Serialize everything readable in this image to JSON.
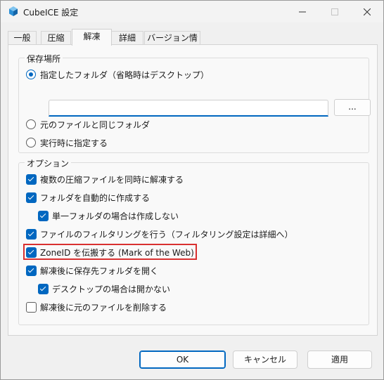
{
  "window": {
    "title": "CubeICE 設定"
  },
  "tabs": [
    "一般",
    "圧縮",
    "解凍",
    "詳細",
    "バージョン情報"
  ],
  "active_tab": "解凍",
  "save_location": {
    "label": "保存場所",
    "options": [
      {
        "label": "指定したフォルダ（省略時はデスクトップ）",
        "selected": true
      },
      {
        "label": "元のファイルと同じフォルダ",
        "selected": false
      },
      {
        "label": "実行時に指定する",
        "selected": false
      }
    ],
    "path_value": "",
    "browse_label": "..."
  },
  "options": {
    "label": "オプション",
    "items": [
      {
        "label": "複数の圧縮ファイルを同時に解凍する",
        "checked": true
      },
      {
        "label": "フォルダを自動的に作成する",
        "checked": true
      },
      {
        "label": "単一フォルダの場合は作成しない",
        "checked": true
      },
      {
        "label": "ファイルのフィルタリングを行う（フィルタリング設定は詳細へ）",
        "checked": true
      },
      {
        "label": "ZoneID を伝搬する (Mark of the Web)",
        "checked": true
      },
      {
        "label": "解凍後に保存先フォルダを開く",
        "checked": true
      },
      {
        "label": "デスクトップの場合は開かない",
        "checked": true
      },
      {
        "label": "解凍後に元のファイルを削除する",
        "checked": false
      }
    ]
  },
  "buttons": {
    "ok": "OK",
    "cancel": "キャンセル",
    "apply": "適用"
  },
  "colors": {
    "accent": "#0067c0",
    "highlight": "#d93030"
  }
}
